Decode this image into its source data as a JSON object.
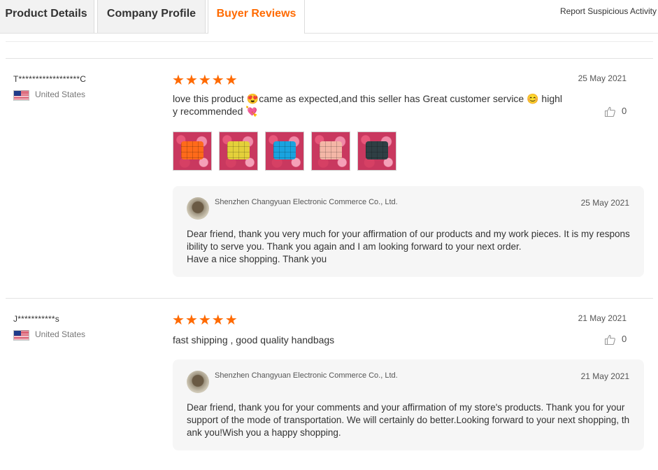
{
  "tabs": [
    {
      "label": "Product Details"
    },
    {
      "label": "Company Profile"
    },
    {
      "label": "Buyer Reviews"
    }
  ],
  "report_link": "Report Suspicious Activity",
  "colors": {
    "accent": "#ff6a00",
    "reply_bg": "#f6f6f6"
  },
  "reviews": [
    {
      "reviewer": "T******************C",
      "country": "United States",
      "flag": "us-flag-icon",
      "stars": "★★★★★",
      "rating": 5,
      "date": "25 May 2021",
      "text": "love this product 😍came as expected,and this seller has Great customer service 😊 highly recommended 💘",
      "likes": "0",
      "photos": [
        "#ff6a1a",
        "#e4d03a",
        "#1aa3df",
        "#f4b6a6",
        "#2f3f44"
      ],
      "reply": {
        "seller": "Shenzhen Changyuan Electronic Commerce Co., Ltd.",
        "date": "25 May 2021",
        "text": "Dear friend, thank you very much for your affirmation of our products and my work pieces. It is my responsibility to serve you. Thank you again and I am looking forward to your next order.\nHave a nice shopping. Thank you"
      }
    },
    {
      "reviewer": "J***********s",
      "country": "United States",
      "flag": "us-flag-icon",
      "stars": "★★★★★",
      "rating": 5,
      "date": "21 May 2021",
      "text": "fast shipping , good quality handbags",
      "likes": "0",
      "reply": {
        "seller": "Shenzhen Changyuan Electronic Commerce Co., Ltd.",
        "date": "21 May 2021",
        "text": "Dear friend, thank you for your comments and your affirmation of my store's products. Thank you for your support of the mode of transportation. We will certainly do better.Looking forward to your next shopping, thank you!Wish you a happy shopping."
      }
    }
  ]
}
